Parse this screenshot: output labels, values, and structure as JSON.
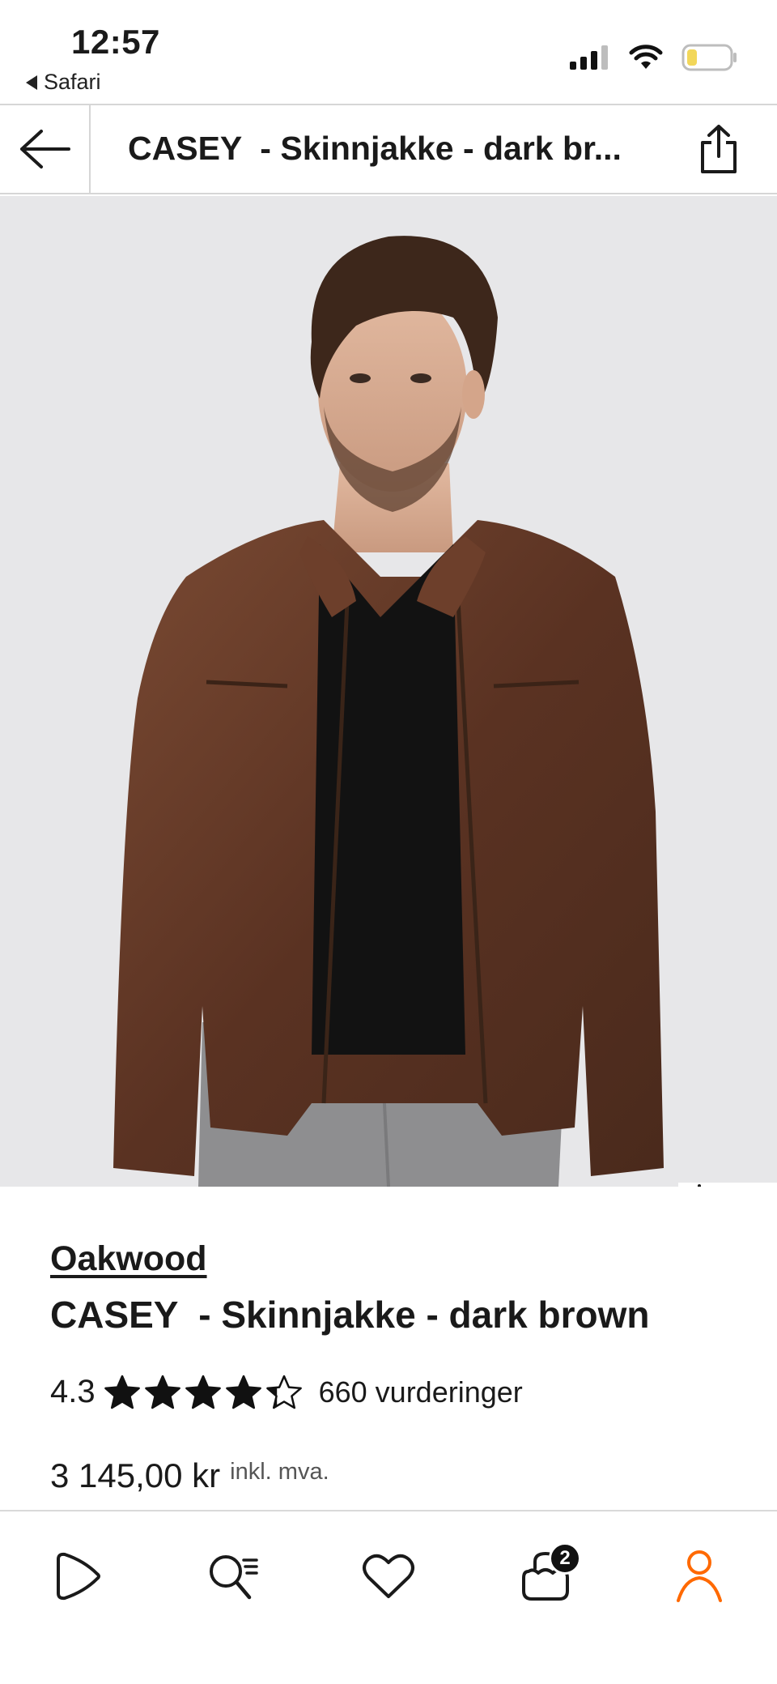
{
  "status_bar": {
    "time": "12:57",
    "back_app_label": "Safari",
    "icons": [
      "signal-icon",
      "wifi-icon",
      "battery-icon"
    ],
    "battery_color": "#f2d75a"
  },
  "header": {
    "title": "CASEY  - Skinnjakke - dark br...",
    "back_icon": "arrow-left-icon",
    "share_icon": "share-icon"
  },
  "image_actions": {
    "notify_icon": "bell-icon",
    "wishlist_icon": "heart-icon",
    "ar_icon": "sparkle-frame-icon"
  },
  "product": {
    "brand": "Oakwood",
    "name": "CASEY  - Skinnjakke - dark brown",
    "rating_value": "4.3",
    "rating_numeric": 4.3,
    "rating_max": 5,
    "review_count": "660 vurderinger",
    "price": "3 145,00 kr",
    "vat_note": "inkl. mva."
  },
  "tab_bar": {
    "items": [
      {
        "name": "tab-home",
        "icon": "play-home-icon"
      },
      {
        "name": "tab-search",
        "icon": "search-list-icon"
      },
      {
        "name": "tab-wishlist",
        "icon": "heart-icon"
      },
      {
        "name": "tab-cart",
        "icon": "shopping-bag-icon",
        "badge": "2"
      },
      {
        "name": "tab-profile",
        "icon": "person-icon",
        "active": true
      }
    ],
    "active_color": "#ff6900"
  }
}
